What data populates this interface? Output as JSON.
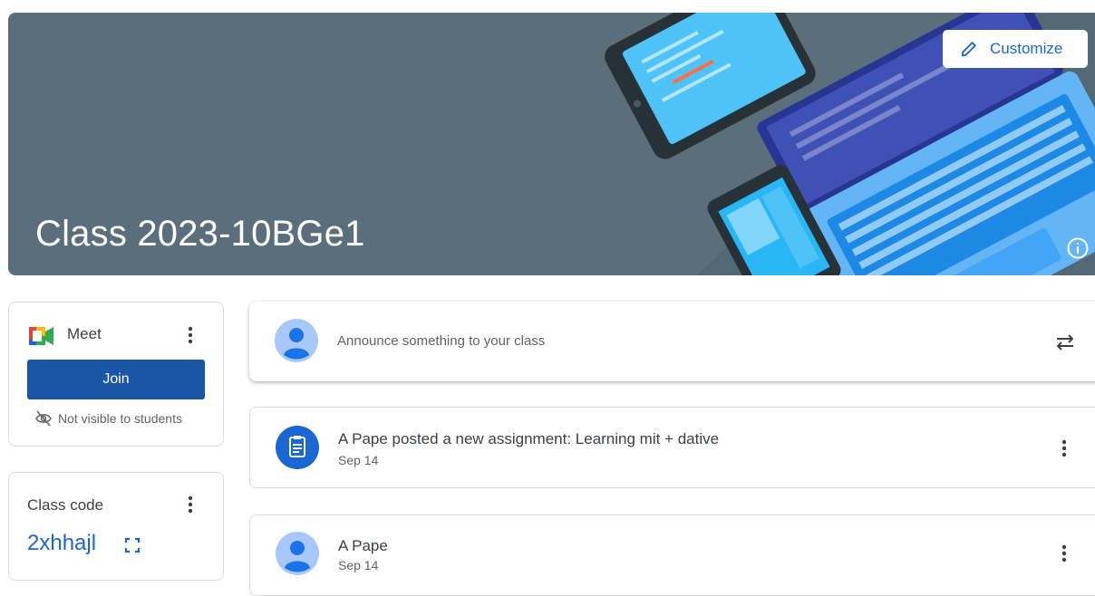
{
  "banner": {
    "class_title": "Class 2023-10BGe1",
    "customize_label": "Customize"
  },
  "meet": {
    "label": "Meet",
    "join_label": "Join",
    "visibility_note": "Not visible to students"
  },
  "class_code": {
    "label": "Class code",
    "value": "2xhhajl"
  },
  "announce": {
    "placeholder": "Announce something to your class"
  },
  "posts": [
    {
      "title": "A Pape posted a new assignment: Learning mit + dative",
      "date": "Sep 14",
      "icon": "assignment-icon"
    },
    {
      "title": "A Pape",
      "date": "Sep 14",
      "icon": "avatar"
    }
  ],
  "colors": {
    "banner": "#5a6e7b",
    "accent": "#1967d2",
    "join_button": "#1a55a8"
  }
}
